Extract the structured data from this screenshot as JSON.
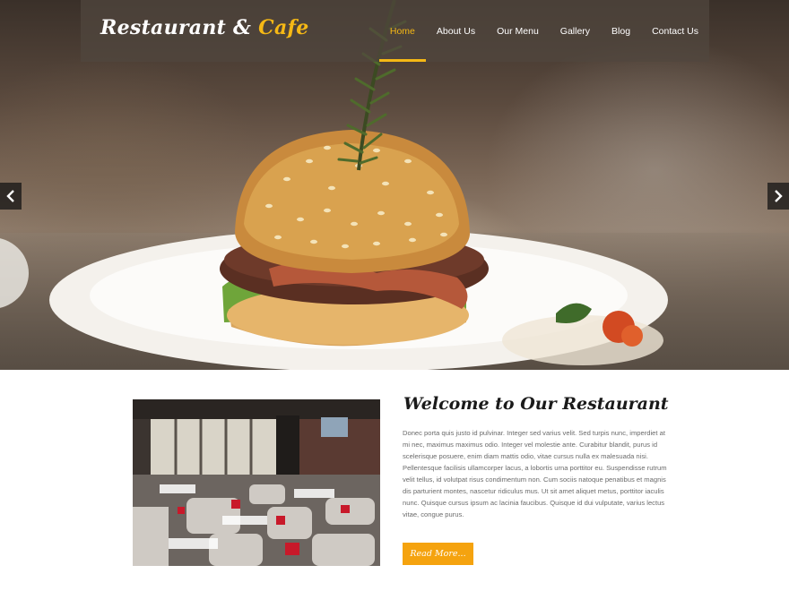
{
  "brand": {
    "logo_main": "Restaurant &",
    "logo_accent": "Cafe",
    "accent_color": "#f5b815"
  },
  "nav": {
    "items": [
      {
        "label": "Home",
        "active": true
      },
      {
        "label": "About Us",
        "active": false
      },
      {
        "label": "Our Menu",
        "active": false
      },
      {
        "label": "Gallery",
        "active": false
      },
      {
        "label": "Blog",
        "active": false
      },
      {
        "label": "Contact Us",
        "active": false
      }
    ]
  },
  "slider": {
    "prev_icon": "chevron-left-icon",
    "next_icon": "chevron-right-icon"
  },
  "welcome": {
    "title": "Welcome to Our Restaurant",
    "body": "Donec porta quis justo id pulvinar. Integer sed varius velit. Sed turpis nunc, imperdiet at mi nec, maximus maximus odio. Integer vel molestie ante. Curabitur blandit, purus id scelerisque posuere, enim diam mattis odio, vitae cursus nulla ex malesuada nisi. Pellentesque facilisis ullamcorper lacus, a lobortis urna porttitor eu. Suspendisse rutrum velit tellus, id volutpat risus condimentum non. Cum sociis natoque penatibus et magnis dis parturient montes, nascetur ridiculus mus. Ut sit amet aliquet metus, porttitor iaculis nunc. Quisque cursus ipsum ac lacinia faucibus. Quisque id dui vulputate, varius lectus vitae, congue purus.",
    "button_label": "Read More...",
    "button_color": "#f5a30f"
  }
}
